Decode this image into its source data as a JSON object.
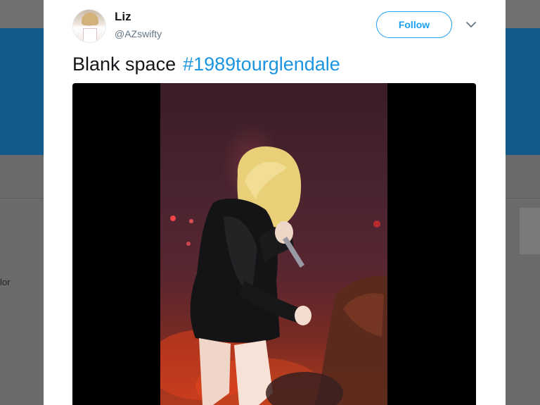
{
  "tweet": {
    "author_name": "Liz",
    "author_handle": "@AZswifty",
    "follow_label": "Follow",
    "text": "Blank space",
    "hashtag": "#1989tourglendale"
  },
  "background_page": {
    "partial_text": "lor"
  },
  "colors": {
    "accent": "#1da1f2",
    "hashtag": "#1b95e0",
    "banner": "#135a8c"
  },
  "icons": {
    "caret": "chevron-down-icon"
  }
}
